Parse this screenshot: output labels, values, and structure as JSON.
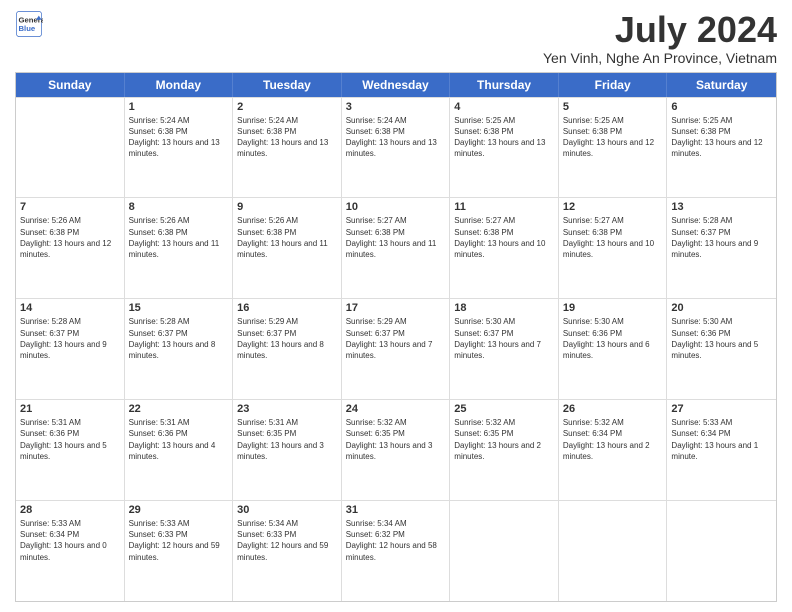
{
  "logo": {
    "line1": "General",
    "line2": "Blue"
  },
  "title": "July 2024",
  "subtitle": "Yen Vinh, Nghe An Province, Vietnam",
  "days": [
    "Sunday",
    "Monday",
    "Tuesday",
    "Wednesday",
    "Thursday",
    "Friday",
    "Saturday"
  ],
  "weeks": [
    [
      {
        "num": "",
        "empty": true
      },
      {
        "num": "1",
        "sunrise": "Sunrise: 5:24 AM",
        "sunset": "Sunset: 6:38 PM",
        "daylight": "Daylight: 13 hours and 13 minutes."
      },
      {
        "num": "2",
        "sunrise": "Sunrise: 5:24 AM",
        "sunset": "Sunset: 6:38 PM",
        "daylight": "Daylight: 13 hours and 13 minutes."
      },
      {
        "num": "3",
        "sunrise": "Sunrise: 5:24 AM",
        "sunset": "Sunset: 6:38 PM",
        "daylight": "Daylight: 13 hours and 13 minutes."
      },
      {
        "num": "4",
        "sunrise": "Sunrise: 5:25 AM",
        "sunset": "Sunset: 6:38 PM",
        "daylight": "Daylight: 13 hours and 13 minutes."
      },
      {
        "num": "5",
        "sunrise": "Sunrise: 5:25 AM",
        "sunset": "Sunset: 6:38 PM",
        "daylight": "Daylight: 13 hours and 12 minutes."
      },
      {
        "num": "6",
        "sunrise": "Sunrise: 5:25 AM",
        "sunset": "Sunset: 6:38 PM",
        "daylight": "Daylight: 13 hours and 12 minutes."
      }
    ],
    [
      {
        "num": "7",
        "sunrise": "Sunrise: 5:26 AM",
        "sunset": "Sunset: 6:38 PM",
        "daylight": "Daylight: 13 hours and 12 minutes."
      },
      {
        "num": "8",
        "sunrise": "Sunrise: 5:26 AM",
        "sunset": "Sunset: 6:38 PM",
        "daylight": "Daylight: 13 hours and 11 minutes."
      },
      {
        "num": "9",
        "sunrise": "Sunrise: 5:26 AM",
        "sunset": "Sunset: 6:38 PM",
        "daylight": "Daylight: 13 hours and 11 minutes."
      },
      {
        "num": "10",
        "sunrise": "Sunrise: 5:27 AM",
        "sunset": "Sunset: 6:38 PM",
        "daylight": "Daylight: 13 hours and 11 minutes."
      },
      {
        "num": "11",
        "sunrise": "Sunrise: 5:27 AM",
        "sunset": "Sunset: 6:38 PM",
        "daylight": "Daylight: 13 hours and 10 minutes."
      },
      {
        "num": "12",
        "sunrise": "Sunrise: 5:27 AM",
        "sunset": "Sunset: 6:38 PM",
        "daylight": "Daylight: 13 hours and 10 minutes."
      },
      {
        "num": "13",
        "sunrise": "Sunrise: 5:28 AM",
        "sunset": "Sunset: 6:37 PM",
        "daylight": "Daylight: 13 hours and 9 minutes."
      }
    ],
    [
      {
        "num": "14",
        "sunrise": "Sunrise: 5:28 AM",
        "sunset": "Sunset: 6:37 PM",
        "daylight": "Daylight: 13 hours and 9 minutes."
      },
      {
        "num": "15",
        "sunrise": "Sunrise: 5:28 AM",
        "sunset": "Sunset: 6:37 PM",
        "daylight": "Daylight: 13 hours and 8 minutes."
      },
      {
        "num": "16",
        "sunrise": "Sunrise: 5:29 AM",
        "sunset": "Sunset: 6:37 PM",
        "daylight": "Daylight: 13 hours and 8 minutes."
      },
      {
        "num": "17",
        "sunrise": "Sunrise: 5:29 AM",
        "sunset": "Sunset: 6:37 PM",
        "daylight": "Daylight: 13 hours and 7 minutes."
      },
      {
        "num": "18",
        "sunrise": "Sunrise: 5:30 AM",
        "sunset": "Sunset: 6:37 PM",
        "daylight": "Daylight: 13 hours and 7 minutes."
      },
      {
        "num": "19",
        "sunrise": "Sunrise: 5:30 AM",
        "sunset": "Sunset: 6:36 PM",
        "daylight": "Daylight: 13 hours and 6 minutes."
      },
      {
        "num": "20",
        "sunrise": "Sunrise: 5:30 AM",
        "sunset": "Sunset: 6:36 PM",
        "daylight": "Daylight: 13 hours and 5 minutes."
      }
    ],
    [
      {
        "num": "21",
        "sunrise": "Sunrise: 5:31 AM",
        "sunset": "Sunset: 6:36 PM",
        "daylight": "Daylight: 13 hours and 5 minutes."
      },
      {
        "num": "22",
        "sunrise": "Sunrise: 5:31 AM",
        "sunset": "Sunset: 6:36 PM",
        "daylight": "Daylight: 13 hours and 4 minutes."
      },
      {
        "num": "23",
        "sunrise": "Sunrise: 5:31 AM",
        "sunset": "Sunset: 6:35 PM",
        "daylight": "Daylight: 13 hours and 3 minutes."
      },
      {
        "num": "24",
        "sunrise": "Sunrise: 5:32 AM",
        "sunset": "Sunset: 6:35 PM",
        "daylight": "Daylight: 13 hours and 3 minutes."
      },
      {
        "num": "25",
        "sunrise": "Sunrise: 5:32 AM",
        "sunset": "Sunset: 6:35 PM",
        "daylight": "Daylight: 13 hours and 2 minutes."
      },
      {
        "num": "26",
        "sunrise": "Sunrise: 5:32 AM",
        "sunset": "Sunset: 6:34 PM",
        "daylight": "Daylight: 13 hours and 2 minutes."
      },
      {
        "num": "27",
        "sunrise": "Sunrise: 5:33 AM",
        "sunset": "Sunset: 6:34 PM",
        "daylight": "Daylight: 13 hours and 1 minute."
      }
    ],
    [
      {
        "num": "28",
        "sunrise": "Sunrise: 5:33 AM",
        "sunset": "Sunset: 6:34 PM",
        "daylight": "Daylight: 13 hours and 0 minutes."
      },
      {
        "num": "29",
        "sunrise": "Sunrise: 5:33 AM",
        "sunset": "Sunset: 6:33 PM",
        "daylight": "Daylight: 12 hours and 59 minutes."
      },
      {
        "num": "30",
        "sunrise": "Sunrise: 5:34 AM",
        "sunset": "Sunset: 6:33 PM",
        "daylight": "Daylight: 12 hours and 59 minutes."
      },
      {
        "num": "31",
        "sunrise": "Sunrise: 5:34 AM",
        "sunset": "Sunset: 6:32 PM",
        "daylight": "Daylight: 12 hours and 58 minutes."
      },
      {
        "num": "",
        "empty": true
      },
      {
        "num": "",
        "empty": true
      },
      {
        "num": "",
        "empty": true
      }
    ]
  ]
}
